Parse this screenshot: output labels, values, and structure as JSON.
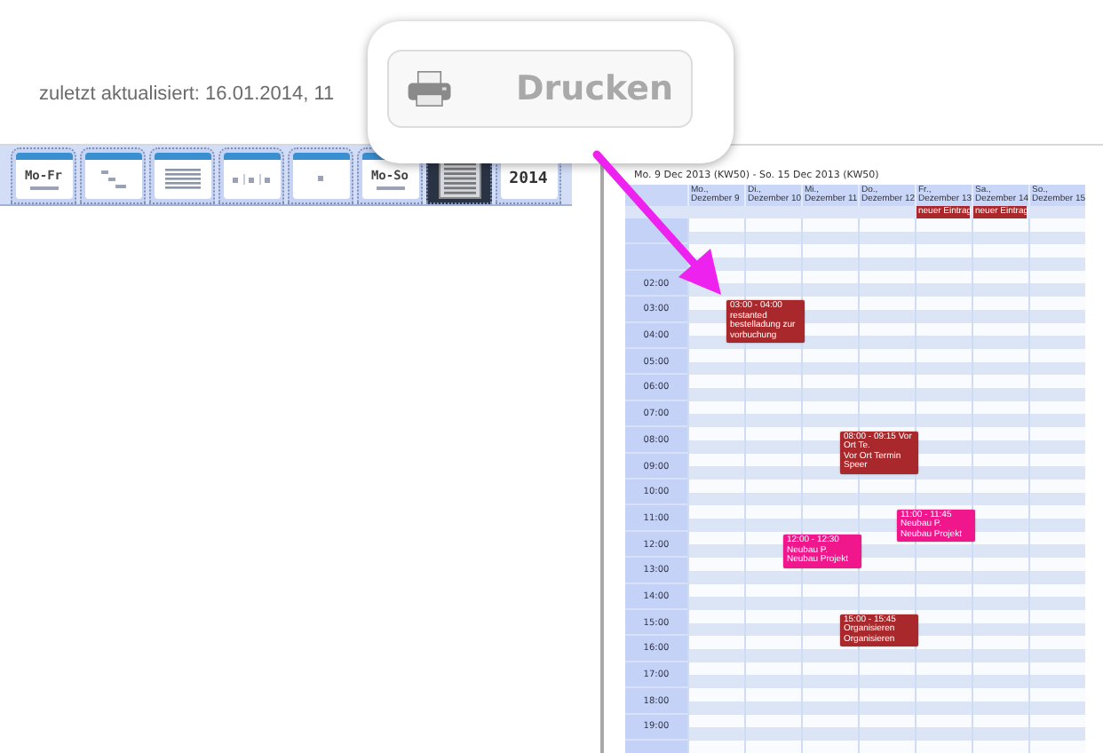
{
  "header": {
    "updated": "zuletzt aktualisiert: 16.01.2014, 11"
  },
  "views": [
    {
      "kind": "week",
      "label": "Mo-Fr",
      "selected": false
    },
    {
      "kind": "tree",
      "selected": false
    },
    {
      "kind": "list",
      "selected": false
    },
    {
      "kind": "columns",
      "selected": false
    },
    {
      "kind": "day",
      "selected": false
    },
    {
      "kind": "week",
      "label": "Mo-So",
      "selected": false
    },
    {
      "kind": "print",
      "selected": true
    },
    {
      "kind": "year",
      "label": "2014",
      "selected": false
    }
  ],
  "print_callout": {
    "button": "Drucken",
    "disabled": true
  },
  "calendar": {
    "title": "Mo. 9 Dec 2013 (KW50) - So. 15 Dec 2013 (KW50)",
    "days": [
      {
        "label": "Mo., Dezember 9",
        "events": [
          {
            "heading": "03:00 - 04:00 restanted",
            "text": "bestelladung zur vorbuchung",
            "color": "#a8282b"
          }
        ]
      },
      {
        "label": "Di., Dezember 10",
        "events": [
          {
            "heading": "12:00 - 12:30 Neubau P.",
            "text": "Neubau Projekt",
            "color": "#f0168c"
          }
        ]
      },
      {
        "label": "Mi., Dezember 11",
        "events": [
          {
            "heading": "08:00 - 09:15 Vor Ort Te.",
            "text": "Vor Ort Termin Speer",
            "color": "#a8282b"
          },
          {
            "heading": "15:00 - 15:45 Organisieren",
            "text": "Organisieren",
            "color": "#a8282b"
          }
        ]
      },
      {
        "label": "Do., Dezember 12",
        "events": [
          {
            "heading": "11:00 - 11:45 Neubau P.",
            "text": "Neubau Projekt",
            "color": "#f0168c"
          }
        ]
      },
      {
        "label": "Fr., Dezember 13",
        "all_day": [
          {
            "text": "neuer Eintrag",
            "color": "#a8282b"
          }
        ]
      },
      {
        "label": "Sa., Dezember 14",
        "all_day": [
          {
            "text": "neuer Eintrag",
            "color": "#a8282b"
          }
        ]
      },
      {
        "label": "So., Dezember 15"
      }
    ],
    "hours": [
      "02:00",
      "03:00",
      "04:00",
      "05:00",
      "06:00",
      "07:00",
      "08:00",
      "09:00",
      "10:00",
      "11:00",
      "12:00",
      "13:00",
      "14:00",
      "15:00",
      "16:00",
      "17:00",
      "18:00",
      "19:00"
    ]
  }
}
